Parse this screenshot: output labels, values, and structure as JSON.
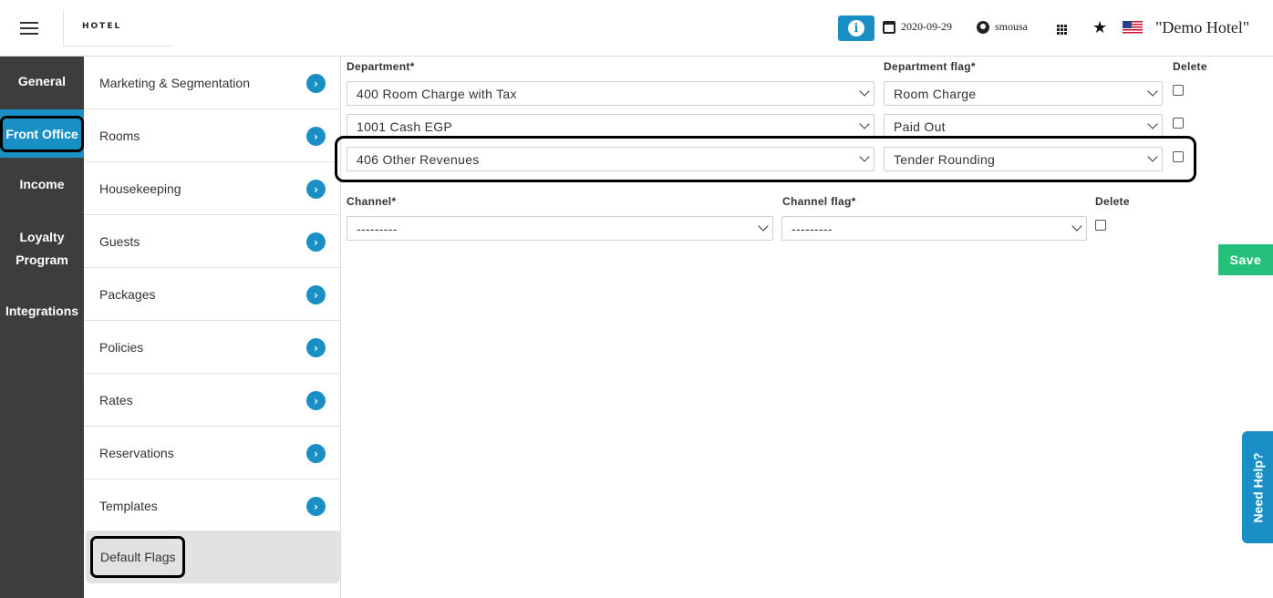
{
  "header": {
    "logo_text": "HOTEL",
    "date": "2020-09-29",
    "username": "smousa",
    "hotel_name": "\"Demo Hotel\"",
    "info_glyph": "i",
    "star_glyph": "★"
  },
  "leftnav": {
    "items": [
      {
        "label": "General"
      },
      {
        "label": "Front Office"
      },
      {
        "label": "Income"
      },
      {
        "label": "Loyalty Program"
      },
      {
        "label": "Integrations"
      }
    ]
  },
  "submenu": {
    "items": [
      {
        "label": "Marketing & Segmentation"
      },
      {
        "label": "Rooms"
      },
      {
        "label": "Housekeeping"
      },
      {
        "label": "Guests"
      },
      {
        "label": "Packages"
      },
      {
        "label": "Policies"
      },
      {
        "label": "Rates"
      },
      {
        "label": "Reservations"
      },
      {
        "label": "Templates"
      },
      {
        "label": "Default Flags"
      }
    ],
    "arrow_glyph": "›"
  },
  "departments": {
    "col_department": "Department*",
    "col_flag": "Department flag*",
    "col_delete": "Delete",
    "rows": [
      {
        "department": "400 Room Charge with Tax",
        "flag": "Room Charge"
      },
      {
        "department": "1001 Cash EGP",
        "flag": "Paid Out"
      },
      {
        "department": "406 Other Revenues",
        "flag": "Tender Rounding"
      }
    ]
  },
  "channels": {
    "col_channel": "Channel*",
    "col_flag": "Channel flag*",
    "col_delete": "Delete",
    "rows": [
      {
        "channel": "---------",
        "flag": "---------"
      }
    ]
  },
  "actions": {
    "save_label": "Save",
    "help_label": "Need Help?"
  },
  "colors": {
    "accent": "#1a8fc6",
    "save": "#25c07a",
    "nav_bg": "#3d3d3d"
  }
}
